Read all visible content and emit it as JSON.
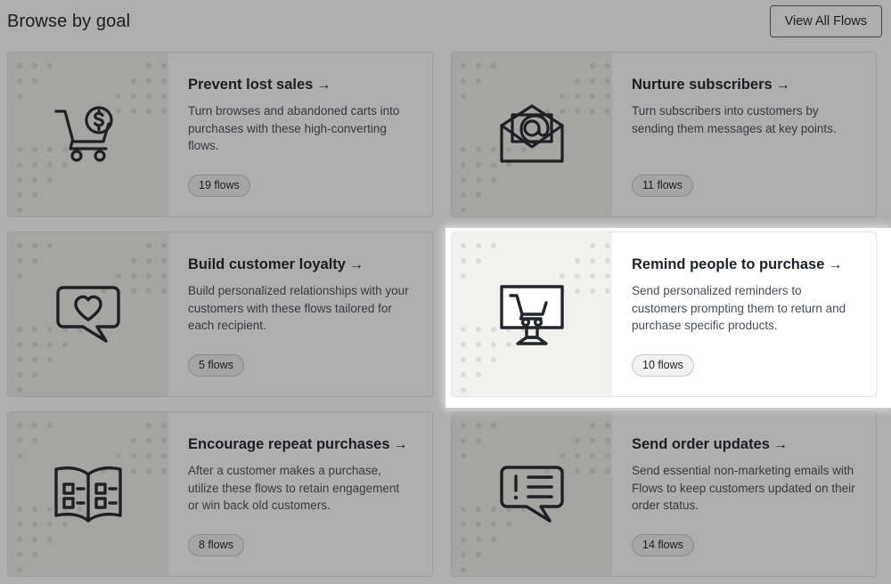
{
  "header": {
    "title": "Browse by goal",
    "view_all_label": "View All Flows"
  },
  "colors": {
    "text_primary": "#1f2329",
    "text_secondary": "#4a4f57",
    "card_border": "#e3e5e8",
    "art_background": "#f1f1ef",
    "dot": "#dcdcd8",
    "badge_border": "#c9cbce",
    "dim_overlay": "rgba(24,24,24,0.35)"
  },
  "arrow_glyph": "→",
  "spotlight": {
    "highlighted_card_index": 3,
    "note": "Remind people to purchase card is spotlighted; rest of page is dimmed"
  },
  "cards": [
    {
      "title": "Prevent lost sales",
      "description": "Turn browses and abandoned carts into purchases with these high-converting flows.",
      "badge": "19 flows",
      "icon": "shopping-cart-dollar-icon",
      "highlighted": false
    },
    {
      "title": "Nurture subscribers",
      "description": "Turn subscribers into customers by sending them messages at key points.",
      "badge": "11 flows",
      "icon": "open-envelope-at-icon",
      "highlighted": false
    },
    {
      "title": "Build customer loyalty",
      "description": "Build personalized relationships with your customers with these flows tailored for each recipient.",
      "badge": "5 flows",
      "icon": "speech-bubble-heart-icon",
      "highlighted": false
    },
    {
      "title": "Remind people to purchase",
      "description": "Send personalized reminders to customers prompting them to return and purchase specific products.",
      "badge": "10 flows",
      "icon": "monitor-shopping-cart-icon",
      "highlighted": true
    },
    {
      "title": "Encourage repeat purchases",
      "description": "After a customer makes a purchase, utilize these flows to retain engagement or win back old customers.",
      "badge": "8 flows",
      "icon": "open-catalog-book-icon",
      "highlighted": false
    },
    {
      "title": "Send order updates",
      "description": "Send essential non-marketing emails with Flows to keep customers updated on their order status.",
      "badge": "14 flows",
      "icon": "speech-bubble-alert-lines-icon",
      "highlighted": false
    }
  ]
}
